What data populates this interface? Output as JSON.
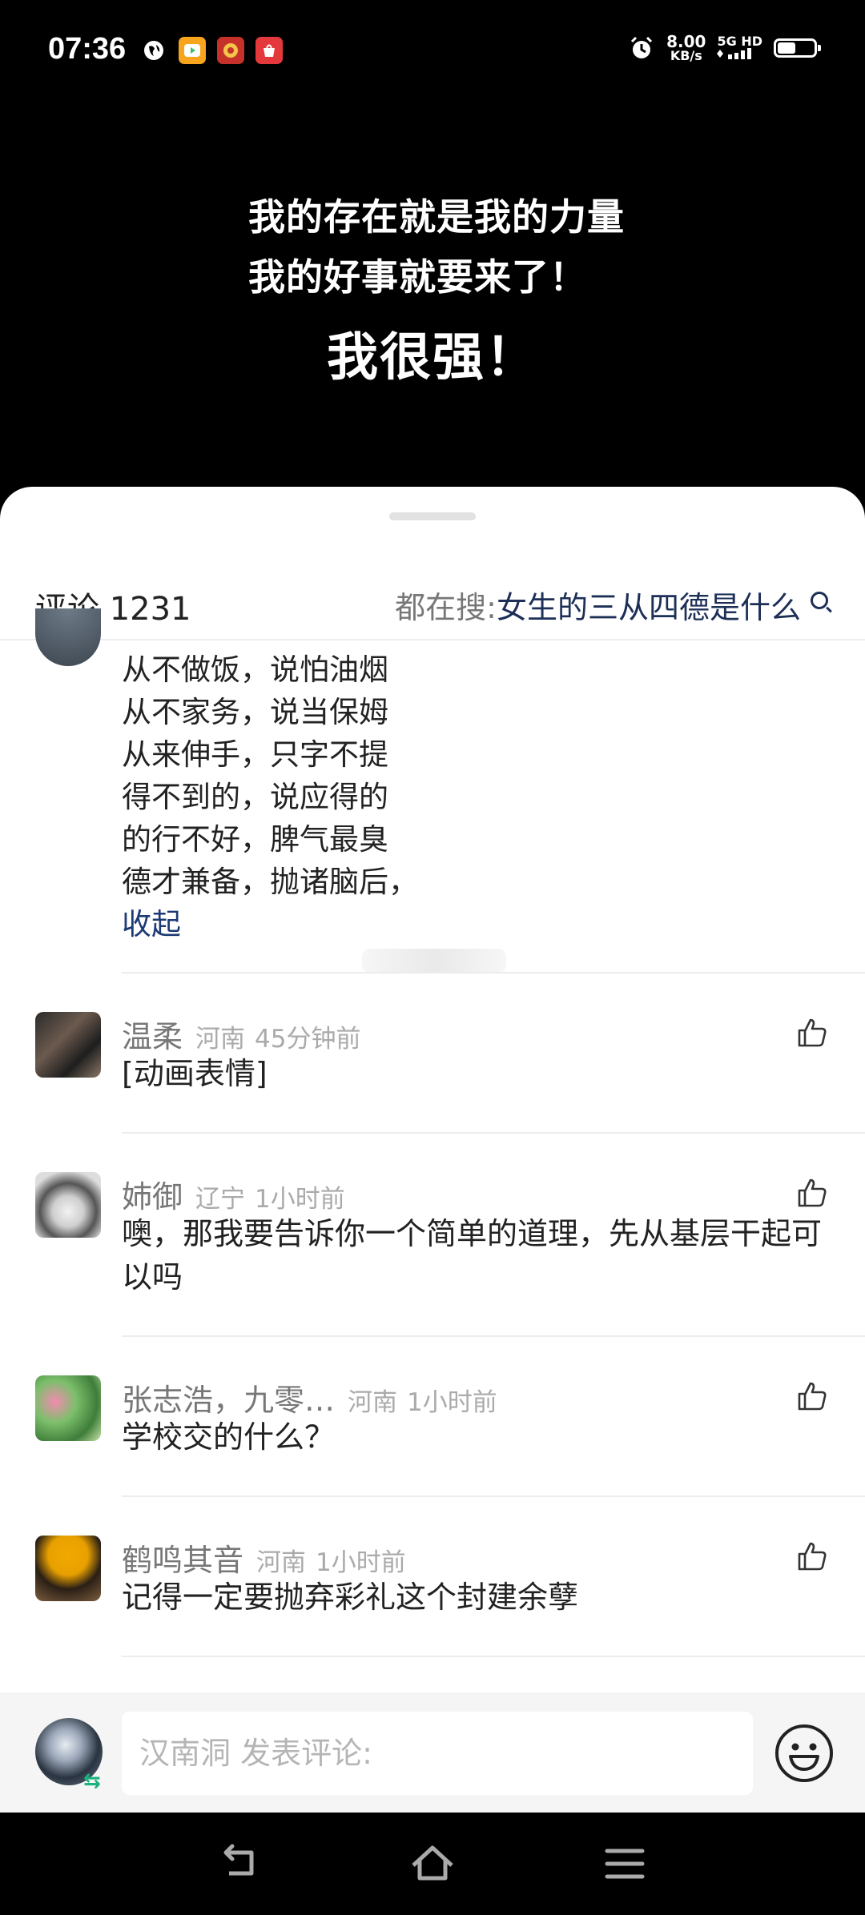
{
  "status_bar": {
    "time": "07:36",
    "net_speed_value": "8.00",
    "net_speed_unit": "KB/s",
    "network": "5G HD",
    "app_icons": [
      "globe-icon",
      "video-app-icon",
      "game-app-icon",
      "shop-app-icon"
    ],
    "battery_level": 0.55
  },
  "video": {
    "line1": "我的存在就是我的力量",
    "line2": "我的好事就要来了！",
    "line3": "我很强！"
  },
  "comments_panel": {
    "title": "评论 1231",
    "hot_search_prefix": "都在搜: ",
    "hot_search_query": "女生的三从四德是什么"
  },
  "expanded_comment": {
    "lines": [
      "从不做饭，说怕油烟",
      "从不家务，说当保姆",
      "从来伸手，只字不提",
      "得不到的，说应得的",
      "的行不好，脾气最臭",
      "德才兼备，抛诸脑后，"
    ],
    "collapse_label": "收起"
  },
  "comments": [
    {
      "username": "温柔",
      "location": "河南",
      "time": "45分钟前",
      "text": "[动画表情]"
    },
    {
      "username": "姉御",
      "location": "辽宁",
      "time": "1小时前",
      "text": "噢，那我要告诉你一个简单的道理，先从基层干起可以吗"
    },
    {
      "username": "张志浩，九零…",
      "location": "河南",
      "time": "1小时前",
      "text": "学校交的什么？"
    },
    {
      "username": "鹤鸣其音",
      "location": "河南",
      "time": "1小时前",
      "text": "记得一定要抛弃彩礼这个封建余孽"
    }
  ],
  "input_bar": {
    "placeholder": "汉南洞 发表评论:",
    "switch_symbol": "⇆"
  },
  "colors": {
    "link": "#1c3a74",
    "accent_green": "#19b37b",
    "meta_gray": "#aaaaaa"
  }
}
